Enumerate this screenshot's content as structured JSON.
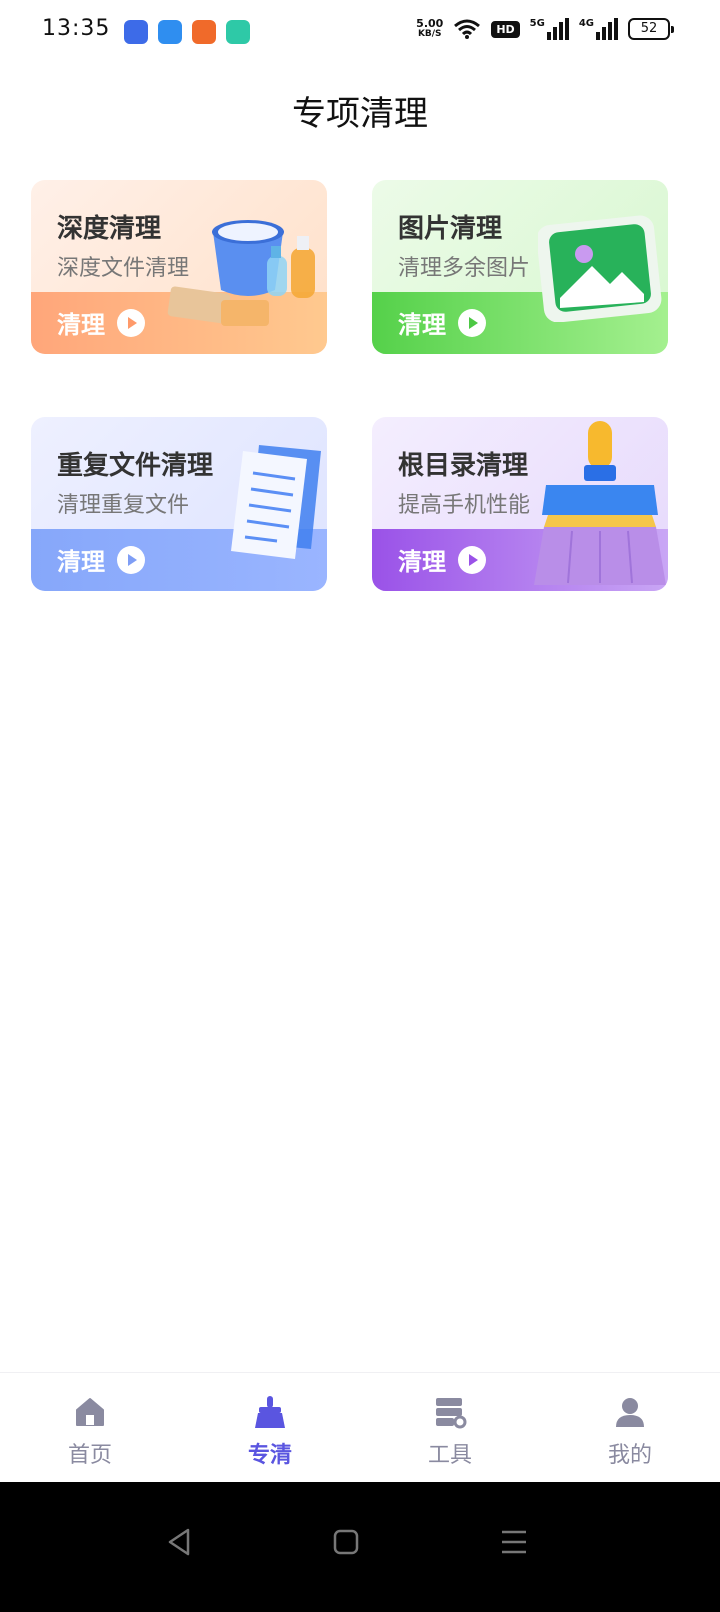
{
  "status_bar": {
    "time": "13:35",
    "net_speed_value": "5.00",
    "net_speed_unit": "KB/S",
    "hd_badge": "HD",
    "signal_1": "5G",
    "signal_2": "4G",
    "battery": "52"
  },
  "page": {
    "title": "专项清理"
  },
  "cards": [
    {
      "title": "深度清理",
      "subtitle": "深度文件清理",
      "button": "清理",
      "illustration": "bucket-cleaning-supplies-icon"
    },
    {
      "title": "图片清理",
      "subtitle": "清理多余图片",
      "button": "清理",
      "illustration": "picture-icon"
    },
    {
      "title": "重复文件清理",
      "subtitle": "清理重复文件",
      "button": "清理",
      "illustration": "documents-icon"
    },
    {
      "title": "根目录清理",
      "subtitle": "提高手机性能",
      "button": "清理",
      "illustration": "broom-icon"
    }
  ],
  "bottom_nav": {
    "items": [
      {
        "label": "首页",
        "icon": "home-icon",
        "active": false
      },
      {
        "label": "专清",
        "icon": "broom-icon",
        "active": true
      },
      {
        "label": "工具",
        "icon": "tools-icon",
        "active": false
      },
      {
        "label": "我的",
        "icon": "user-icon",
        "active": false
      }
    ]
  },
  "colors": {
    "accent": "#5a55e0",
    "nav_inactive": "#8a8aa0",
    "card1": "#ffa67a",
    "card2": "#55d14a",
    "card3": "#86a7fa",
    "card4": "#9a52e8"
  }
}
